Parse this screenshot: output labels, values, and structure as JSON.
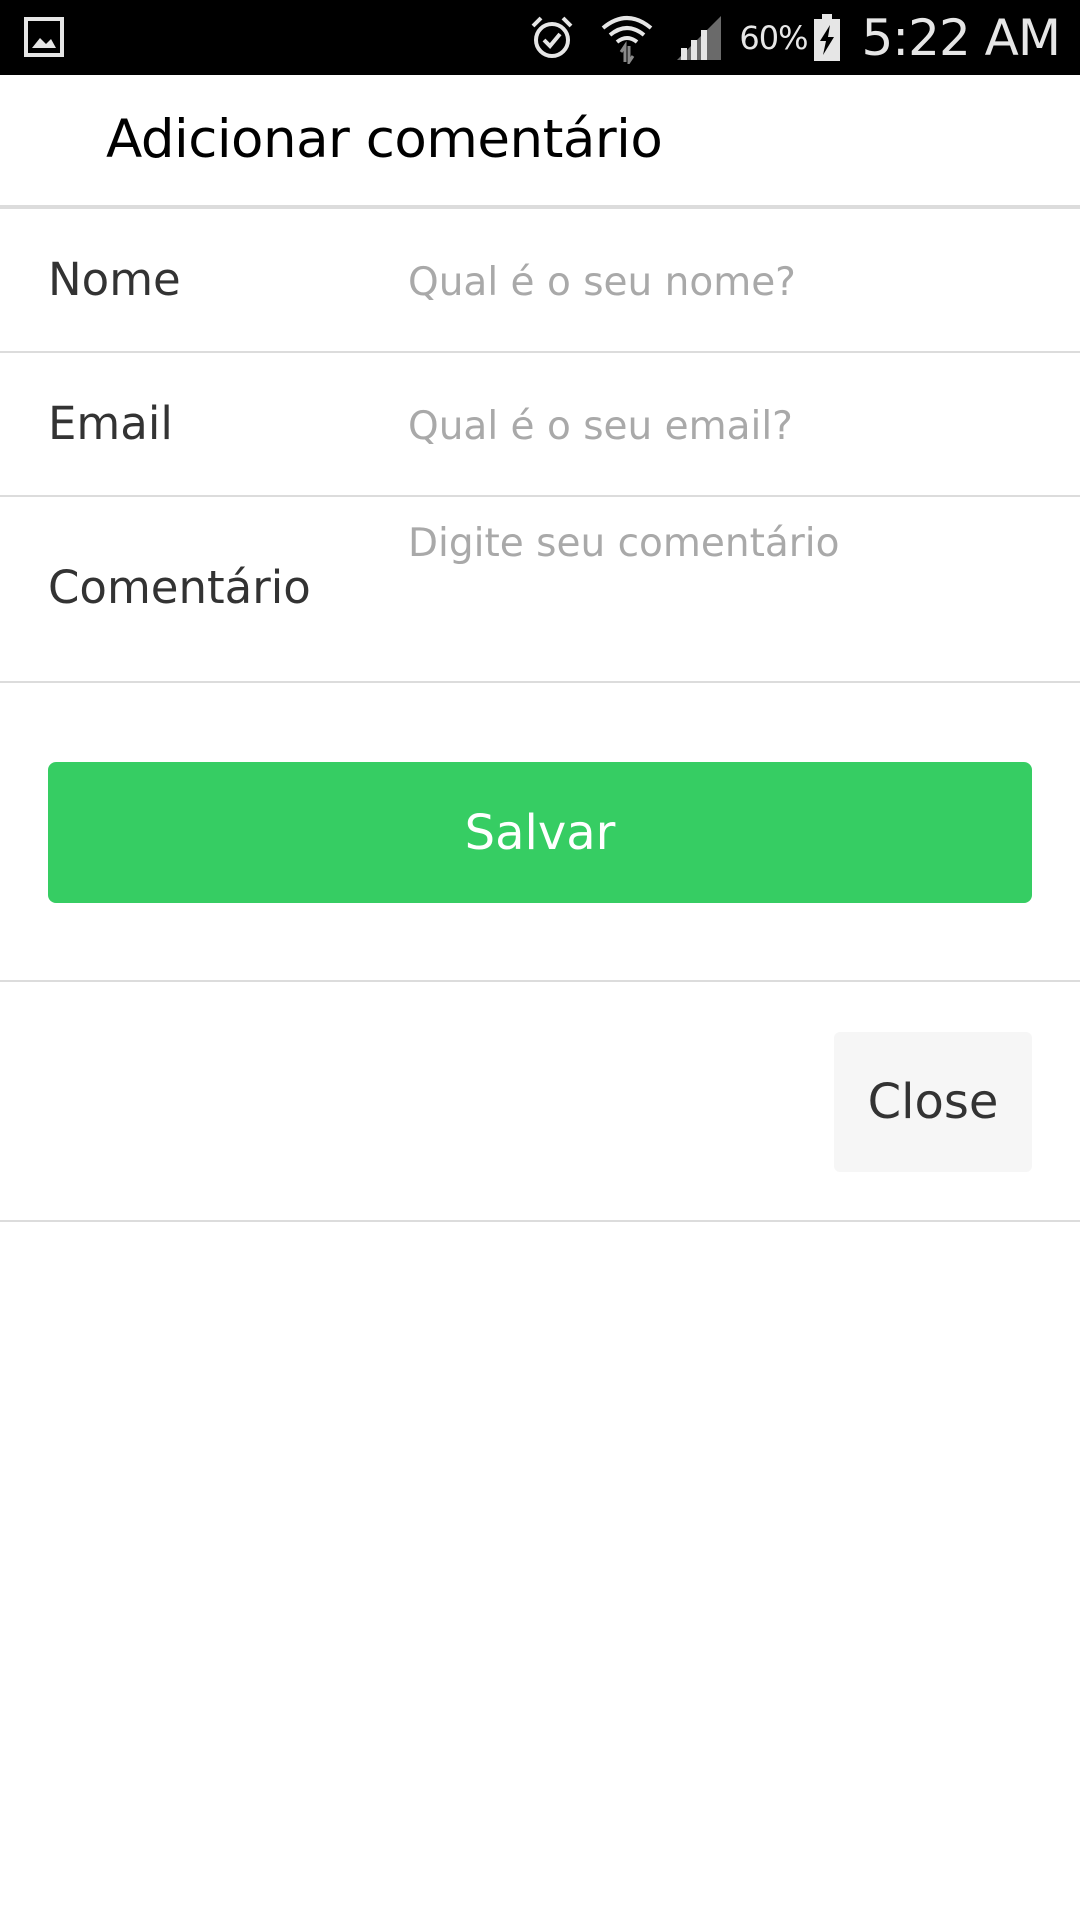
{
  "status_bar": {
    "left_icon": "gallery-notification-icon",
    "icons": [
      "alarm-icon",
      "wifi-icon",
      "cell-signal-icon",
      "battery-charging-icon"
    ],
    "battery_percent": "60%",
    "time": "5:22 AM"
  },
  "header": {
    "title": "Adicionar comentário"
  },
  "form": {
    "name": {
      "label": "Nome",
      "placeholder": "Qual é o seu nome?"
    },
    "email": {
      "label": "Email",
      "placeholder": "Qual é o seu email?"
    },
    "comment": {
      "label": "Comentário",
      "placeholder": "Digite seu comentário"
    }
  },
  "buttons": {
    "save_label": "Salvar",
    "close_label": "Close"
  },
  "colors": {
    "status_bar_bg": "#000000",
    "save_button_bg": "#36cd63",
    "close_button_bg": "#f6f6f6",
    "divider": "#dcdcdc",
    "placeholder": "#a9a9a9"
  }
}
